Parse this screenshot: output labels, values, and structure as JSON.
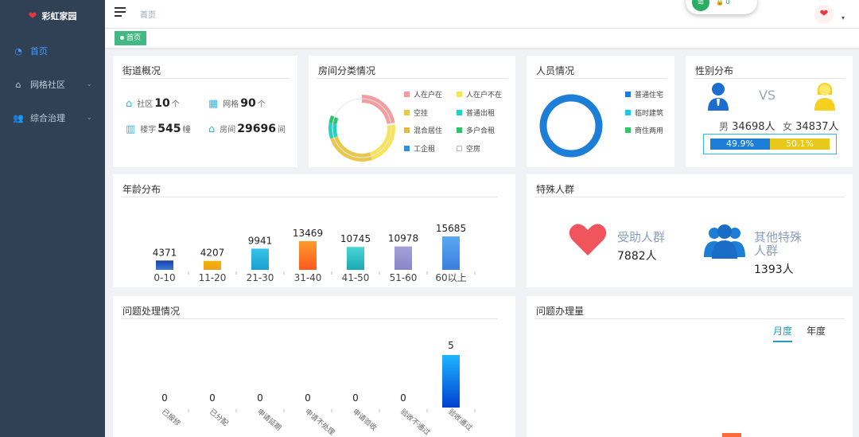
{
  "sidebar": {
    "logo": "彩虹家园",
    "items": [
      {
        "label": "首页"
      },
      {
        "label": "网格社区"
      },
      {
        "label": "综合治理"
      }
    ]
  },
  "topbar": {
    "breadcrumb": "首页",
    "net_count": "0"
  },
  "tags": {
    "home": "首页"
  },
  "street": {
    "title": "街道概况",
    "items": [
      {
        "label": "社区",
        "value": "10",
        "unit": "个"
      },
      {
        "label": "网格",
        "value": "90",
        "unit": "个"
      },
      {
        "label": "楼宇",
        "value": "545",
        "unit": "幢"
      },
      {
        "label": "房间",
        "value": "29696",
        "unit": "间"
      }
    ]
  },
  "rooms": {
    "title": "房间分类情况",
    "legend": [
      {
        "label": "人在户在",
        "color": "#f39da1"
      },
      {
        "label": "人在户不在",
        "color": "#f7e45a"
      },
      {
        "label": "空挂",
        "color": "#e8c84a"
      },
      {
        "label": "普通出租",
        "color": "#1fd1c9"
      },
      {
        "label": "混合居住",
        "color": "#e6b84a"
      },
      {
        "label": "多户合租",
        "color": "#2ec46a"
      },
      {
        "label": "工企租",
        "color": "#2f8fe0"
      },
      {
        "label": "空房",
        "color": "#ffffff"
      }
    ]
  },
  "people": {
    "title": "人员情况",
    "legend": [
      {
        "label": "普通住宅",
        "color": "#1c7ed6"
      },
      {
        "label": "临时建筑",
        "color": "#1fc8e8"
      },
      {
        "label": "商住两用",
        "color": "#2ec46a"
      }
    ]
  },
  "gender": {
    "title": "性别分布",
    "vs": "VS",
    "male_label": "男",
    "male_value": "34698人",
    "female_label": "女",
    "female_value": "34837人",
    "male_pct": "49.9%",
    "female_pct": "50.1%",
    "male_share": 0.499
  },
  "age": {
    "title": "年龄分布"
  },
  "special": {
    "title": "特殊人群",
    "aid_label": "受助人群",
    "aid_value": "7882人",
    "other_label_1": "其他特殊",
    "other_label_2": "人群",
    "other_value": "1393人"
  },
  "issues": {
    "title": "问题处理情况"
  },
  "volume": {
    "title": "问题办理量",
    "tabs": [
      {
        "label": "月度"
      },
      {
        "label": "年度"
      }
    ]
  },
  "chart_data": [
    {
      "type": "bar",
      "categories": [
        "0-10",
        "11-20",
        "21-30",
        "31-40",
        "41-50",
        "51-60",
        "60以上"
      ],
      "values": [
        4371,
        4207,
        9941,
        13469,
        10745,
        10978,
        15685
      ],
      "colors": [
        [
          "#1b3fa8",
          "#3a7bd5"
        ],
        [
          "#f5b400",
          "#f0a020"
        ],
        [
          "#36c3e8",
          "#1a9fd0"
        ],
        [
          "#ff9a2e",
          "#ff5a1e"
        ],
        [
          "#4ad6d6",
          "#1aa8b4"
        ],
        [
          "#a3a0d8",
          "#8a86c8"
        ],
        [
          "#5aa8f0",
          "#3a7fe0"
        ]
      ],
      "ylim": [
        0,
        15685
      ]
    },
    {
      "type": "bar",
      "categories": [
        "已报修",
        "已分配",
        "申请延期",
        "申请不处理",
        "申请验收",
        "验收不通过",
        "验收通过"
      ],
      "values": [
        0,
        0,
        0,
        0,
        0,
        0,
        5
      ],
      "ylim": [
        0,
        5
      ]
    }
  ]
}
